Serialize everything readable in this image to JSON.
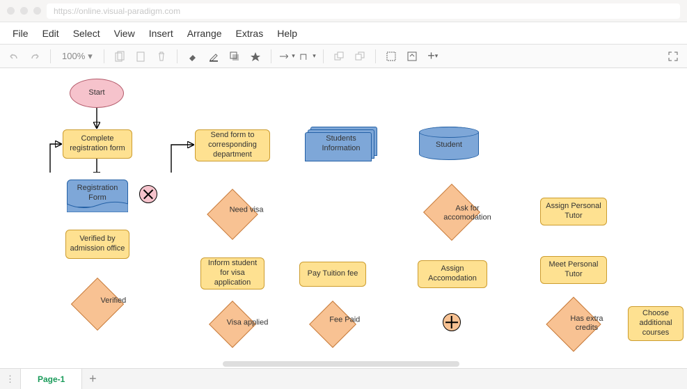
{
  "url": "https://online.visual-paradigm.com",
  "menu": {
    "file": "File",
    "edit": "Edit",
    "select": "Select",
    "view": "View",
    "insert": "Insert",
    "arrange": "Arrange",
    "extras": "Extras",
    "help": "Help"
  },
  "toolbar": {
    "zoom": "100%"
  },
  "tabs": {
    "page1": "Page-1"
  },
  "nodes": {
    "start": "Start",
    "complete_registration": "Complete registration form",
    "registration_form": "Registration Form",
    "verified_office": "Verified by admission office",
    "verified": "Verified",
    "send_form": "Send form to corresponding department",
    "students_info": "Students Information",
    "student": "Student",
    "need_visa": "Need visa",
    "inform_visa": "Inform student for visa application",
    "visa_applied": "Visa applied",
    "pay_tuition": "Pay Tuition fee",
    "fee_paid": "Fee Paid",
    "ask_accom": "Ask for accomodation",
    "assign_accom": "Assign Accomodation",
    "assign_tutor": "Assign Personal Tutor",
    "meet_tutor": "Meet Personal Tutor",
    "has_credits": "Has extra credits",
    "choose_courses": "Choose additional courses"
  }
}
